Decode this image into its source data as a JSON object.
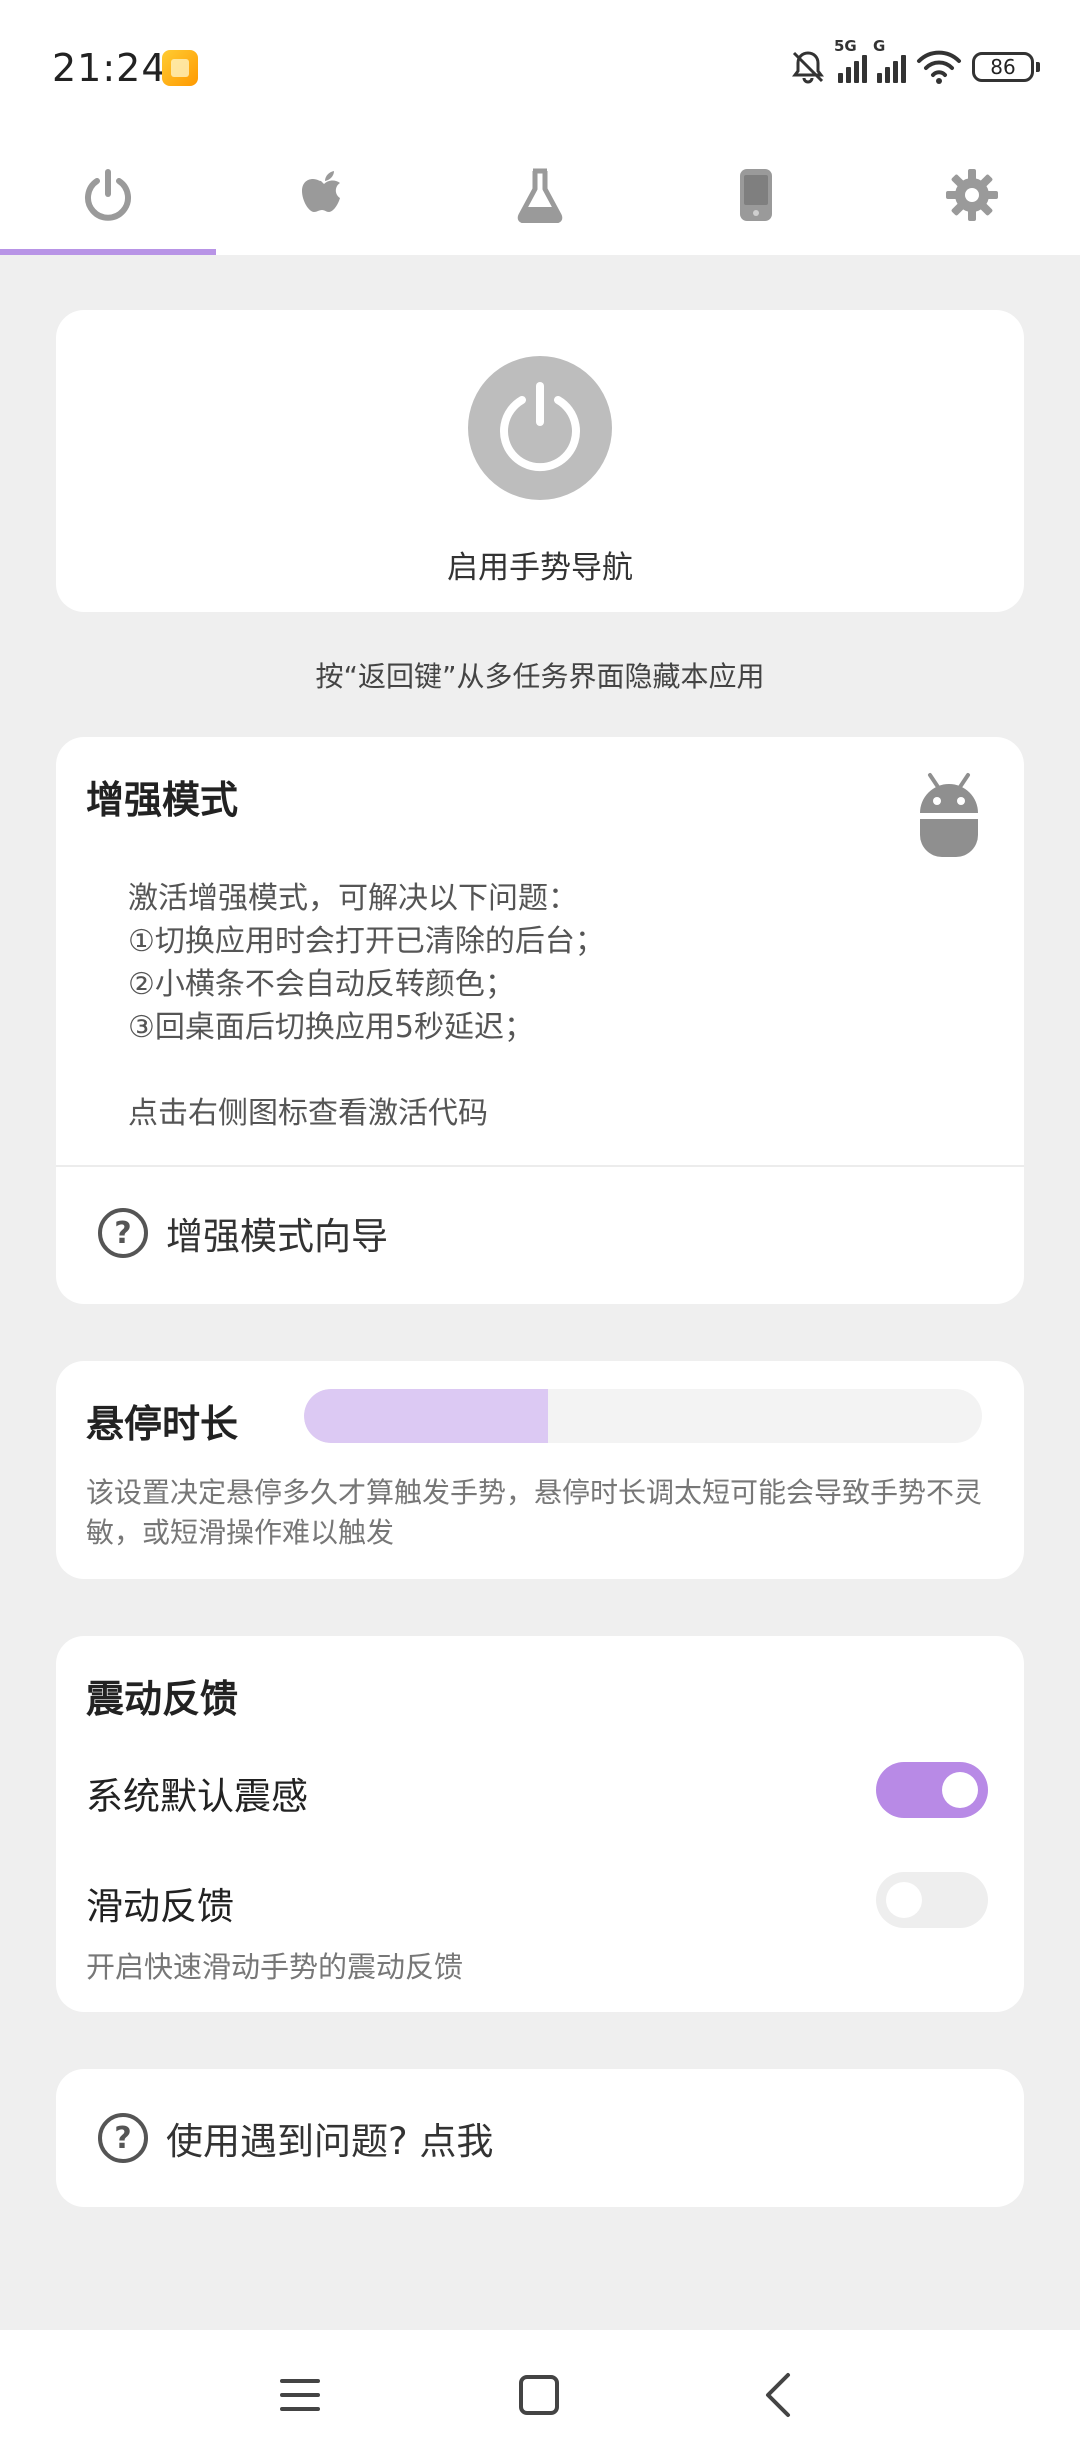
{
  "status_bar": {
    "time": "21:24",
    "network_1": "5G",
    "network_2": "G",
    "battery": "86"
  },
  "tabs": [
    {
      "icon": "power-icon",
      "active": true
    },
    {
      "icon": "apple-icon",
      "active": false
    },
    {
      "icon": "flask-icon",
      "active": false
    },
    {
      "icon": "phone-icon",
      "active": false
    },
    {
      "icon": "gear-icon",
      "active": false
    }
  ],
  "power_card": {
    "label": "启用手势导航"
  },
  "hint": "按“返回键”从多任务界面隐藏本应用",
  "enhanced": {
    "title": "增强模式",
    "description": "激活增强模式，可解决以下问题：\n①切换应用时会打开已清除的后台；\n②小横条不会自动反转颜色；\n③回桌面后切换应用5秒延迟；\n\n点击右侧图标查看激活代码",
    "guide_label": "增强模式向导",
    "icon": "android-icon"
  },
  "hover": {
    "title": "悬停时长",
    "level_percent": 36,
    "description": "该设置决定悬停多久才算触发手势，悬停时长调太短可能会导致手势不灵敏，或短滑操作难以触发"
  },
  "vibration": {
    "title": "震动反馈",
    "system_default_label": "系统默认震感",
    "system_default_on": true,
    "swipe_label": "滑动反馈",
    "swipe_sub": "开启快速滑动手势的震动反馈",
    "swipe_on": false
  },
  "help": {
    "label": "使用遇到问题? 点我"
  },
  "colors": {
    "accent": "#b88ae6",
    "accent_light": "#dcc9f3",
    "background": "#efefef",
    "card": "#ffffff"
  }
}
